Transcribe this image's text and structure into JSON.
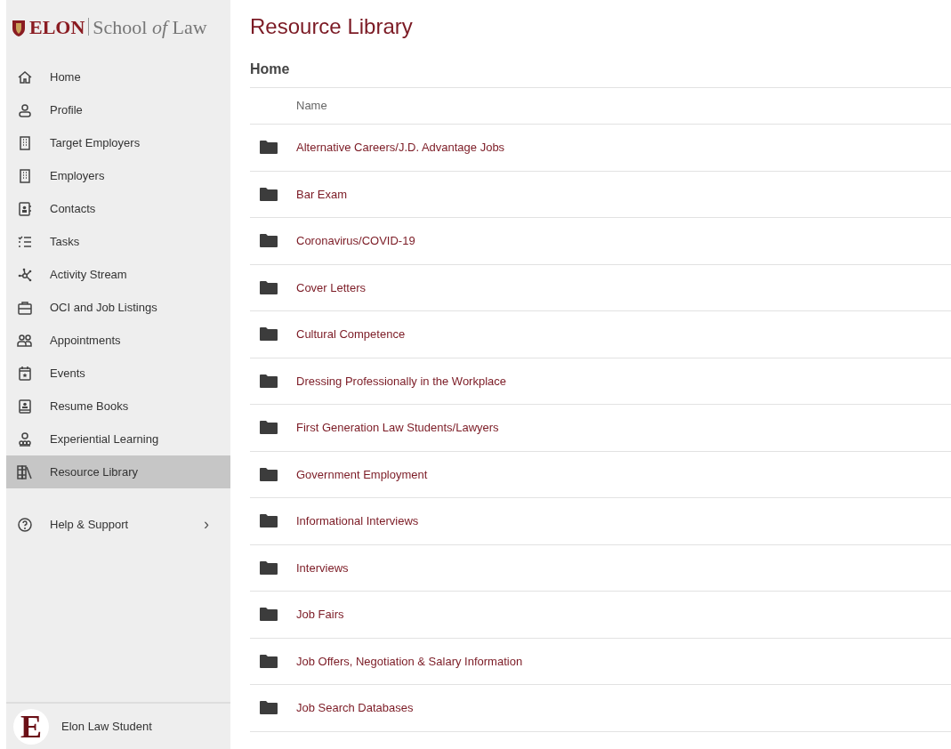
{
  "sidebar": {
    "logo": {
      "brand": "ELON",
      "subtitle": "School *of* Law"
    },
    "items": [
      {
        "kind": "home",
        "label": "Home",
        "selected": false
      },
      {
        "kind": "person",
        "label": "Profile",
        "selected": false
      },
      {
        "kind": "building",
        "label": "Target Employers",
        "selected": false
      },
      {
        "kind": "building",
        "label": "Employers",
        "selected": false
      },
      {
        "kind": "contact",
        "label": "Contacts",
        "selected": false
      },
      {
        "kind": "tasks",
        "label": "Tasks",
        "selected": false
      },
      {
        "kind": "network",
        "label": "Activity Stream",
        "selected": false
      },
      {
        "kind": "briefcase",
        "label": "OCI and Job Listings",
        "selected": false
      },
      {
        "kind": "people",
        "label": "Appointments",
        "selected": false
      },
      {
        "kind": "calendar",
        "label": "Events",
        "selected": false
      },
      {
        "kind": "book",
        "label": "Resume Books",
        "selected": false
      },
      {
        "kind": "group",
        "label": "Experiential Learning",
        "selected": false
      },
      {
        "kind": "library",
        "label": "Resource Library",
        "selected": true
      }
    ],
    "help": {
      "label": "Help & Support",
      "chevron": "›"
    },
    "user": {
      "avatar_letter": "E",
      "name": "Elon Law Student"
    }
  },
  "main": {
    "title": "Resource Library",
    "breadcrumb": "Home",
    "table": {
      "columns": [
        "Name"
      ],
      "rows": [
        "Alternative Careers/J.D. Advantage Jobs",
        "Bar Exam",
        "Coronavirus/COVID-19",
        "Cover Letters",
        "Cultural Competence",
        "Dressing Professionally in the Workplace",
        "First Generation Law Students/Lawyers",
        "Government Employment",
        "Informational Interviews",
        "Interviews",
        "Job Fairs",
        "Job Offers, Negotiation & Salary Information",
        "Job Search Databases"
      ]
    }
  }
}
